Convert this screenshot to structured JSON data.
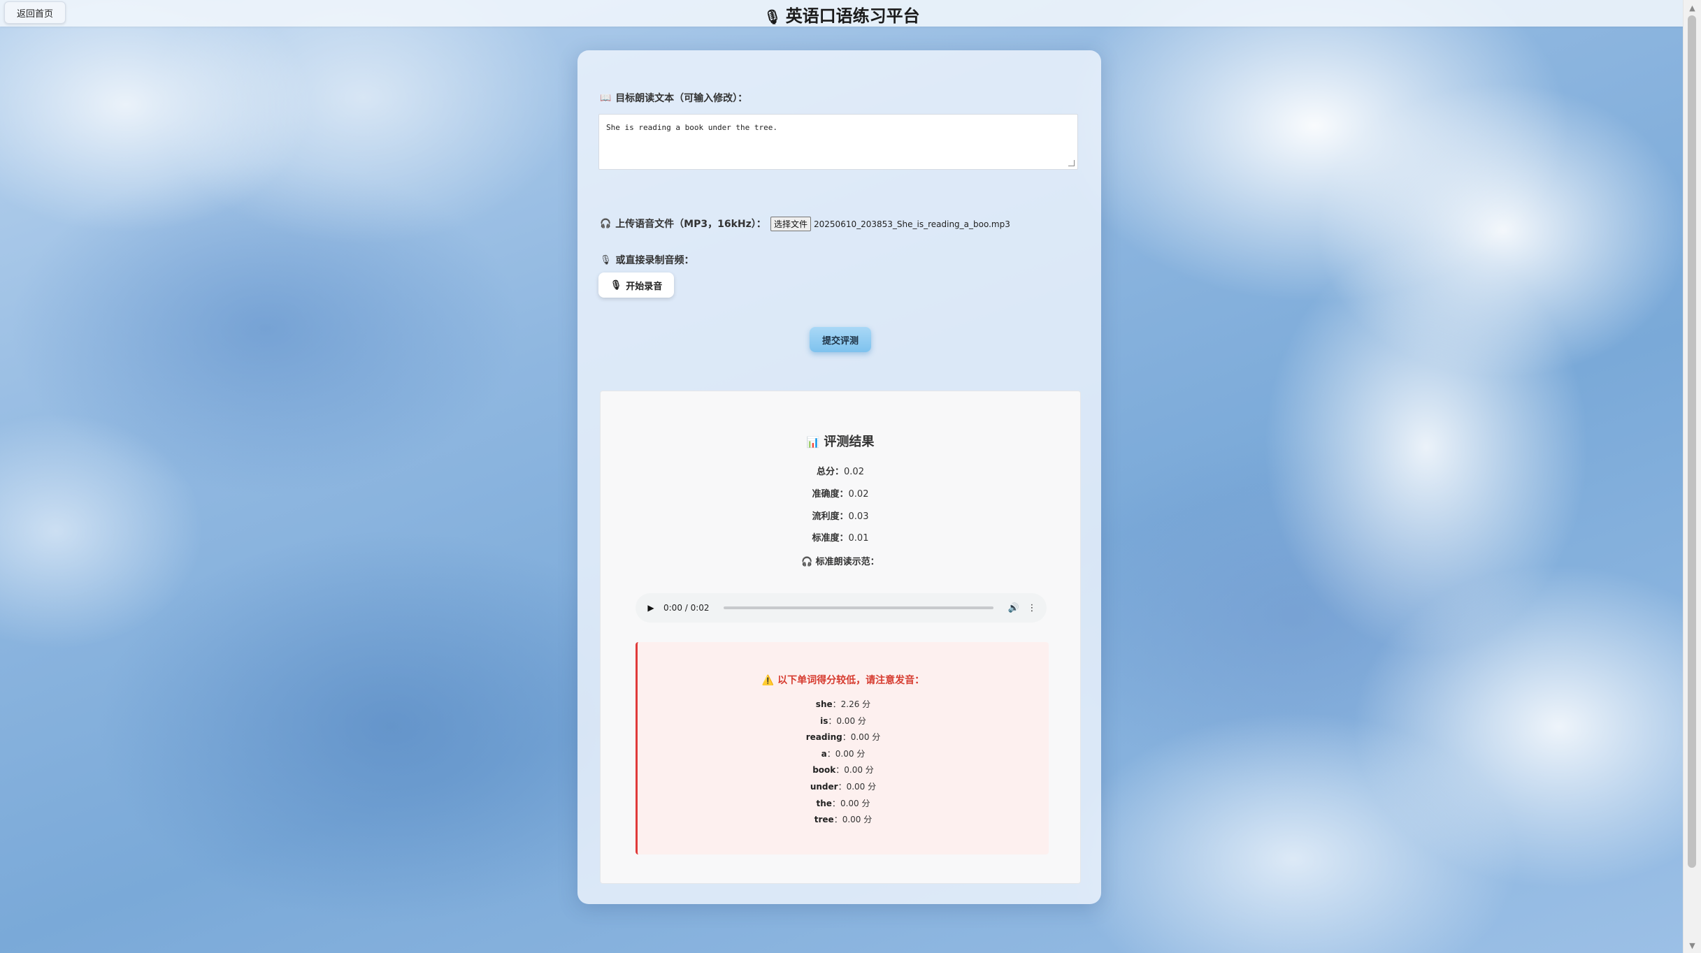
{
  "topbar": {
    "back_label": "返回首页",
    "title_emoji": "🎙",
    "title": "英语口语练习平台"
  },
  "form": {
    "target_text_icon": "📖",
    "target_text_label": "目标朗读文本（可输入修改）：",
    "target_text_value": "She is reading a book under the tree.",
    "upload_icon": "🎧",
    "upload_label": "上传语音文件（MP3，16kHz）：",
    "file_button_label": "选择文件",
    "file_name": "20250610_203853_She_is_reading_a_boo.mp3",
    "record_icon": "🎙",
    "record_label": "或直接录制音频：",
    "record_button_icon": "🎙",
    "record_button_label": "开始录音",
    "submit_label": "提交评测"
  },
  "result": {
    "title_icon": "📊",
    "title": "评测结果",
    "scores": [
      {
        "label": "总分：",
        "value": "0.02"
      },
      {
        "label": "准确度：",
        "value": "0.02"
      },
      {
        "label": "流利度：",
        "value": "0.03"
      },
      {
        "label": "标准度：",
        "value": "0.01"
      }
    ],
    "demo_icon": "🎧",
    "demo_label": "标准朗读示范：",
    "audio": {
      "time": "0:00 / 0:02",
      "progress": 0,
      "play_icon": "play-icon",
      "volume_icon": "volume-icon",
      "more_icon": "more-vert-icon"
    },
    "warning": {
      "icon": "⚠️",
      "title": "以下单词得分较低，请注意发音：",
      "words": [
        {
          "word": "she",
          "score": "2.26 分"
        },
        {
          "word": "is",
          "score": "0.00 分"
        },
        {
          "word": "reading",
          "score": "0.00 分"
        },
        {
          "word": "a",
          "score": "0.00 分"
        },
        {
          "word": "book",
          "score": "0.00 分"
        },
        {
          "word": "under",
          "score": "0.00 分"
        },
        {
          "word": "the",
          "score": "0.00 分"
        },
        {
          "word": "tree",
          "score": "0.00 分"
        }
      ]
    }
  },
  "colors": {
    "accent_blue": "#7ec2ee",
    "warning_red": "#d63b2f",
    "warning_bg": "#fdf0ef"
  }
}
